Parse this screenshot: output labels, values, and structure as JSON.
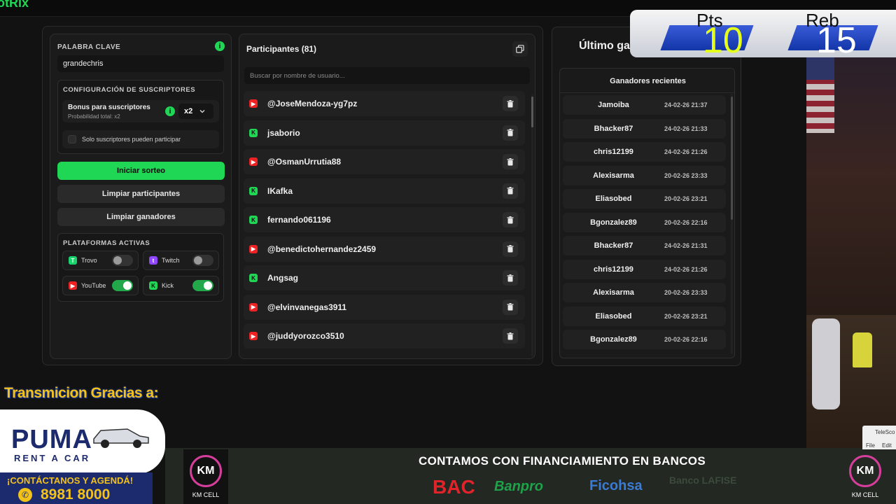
{
  "brand": "otRix",
  "left": {
    "keyword_label": "PALABRA CLAVE",
    "keyword_value": "grandechris",
    "subs_config_label": "CONFIGURACIÓN DE SUSCRIPTORES",
    "bonus_title": "Bonus para suscriptores",
    "bonus_sub": "Probabilidad total: x2",
    "bonus_select": "x2",
    "only_subs": "Solo suscriptores pueden participar",
    "start_btn": "Iniciar sorteo",
    "clear_participants_btn": "Limpiar participantes",
    "clear_winners_btn": "Limpiar ganadores",
    "platforms_label": "PLATAFORMAS ACTIVAS",
    "platforms": [
      {
        "name": "Trovo",
        "icon": "trovo-icon",
        "on": false
      },
      {
        "name": "Twitch",
        "icon": "twitch-icon",
        "on": false
      },
      {
        "name": "YouTube",
        "icon": "youtube-icon",
        "on": true
      },
      {
        "name": "Kick",
        "icon": "kick-icon",
        "on": true
      }
    ]
  },
  "participants": {
    "title": "Participantes (81)",
    "search_placeholder": "Buscar por nombre de usuario...",
    "items": [
      {
        "name": "@JoseMendoza-yg7pz",
        "platform": "youtube"
      },
      {
        "name": "jsaborio",
        "platform": "kick"
      },
      {
        "name": "@OsmanUrrutia88",
        "platform": "youtube"
      },
      {
        "name": "IKafka",
        "platform": "kick"
      },
      {
        "name": "fernando061196",
        "platform": "kick"
      },
      {
        "name": "@benedictohernandez2459",
        "platform": "youtube"
      },
      {
        "name": "Angsag",
        "platform": "kick"
      },
      {
        "name": "@elvinvanegas3911",
        "platform": "youtube"
      },
      {
        "name": "@juddyorozco3510",
        "platform": "youtube"
      }
    ]
  },
  "winners": {
    "header": "Último ga",
    "title": "Ganadores recientes",
    "items": [
      {
        "name": "Jamoiba",
        "date": "24-02-26 21:37"
      },
      {
        "name": "Bhacker87",
        "date": "24-02-26 21:33"
      },
      {
        "name": "chris12199",
        "date": "24-02-26 21:26"
      },
      {
        "name": "Alexisarma",
        "date": "20-02-26 23:33"
      },
      {
        "name": "Eliasobed",
        "date": "20-02-26 23:21"
      },
      {
        "name": "Bgonzalez89",
        "date": "20-02-26 22:16"
      },
      {
        "name": "Bhacker87",
        "date": "24-02-26 21:31"
      },
      {
        "name": "chris12199",
        "date": "24-02-26 21:26"
      },
      {
        "name": "Alexisarma",
        "date": "20-02-26 23:33"
      },
      {
        "name": "Eliasobed",
        "date": "20-02-26 23:21"
      },
      {
        "name": "Bgonzalez89",
        "date": "20-02-26 22:16"
      }
    ]
  },
  "scoreboard": {
    "pts_label": "Pts",
    "pts_value": "10",
    "reb_label": "Reb",
    "reb_value": "15"
  },
  "overlay": {
    "thanks": "Transmicion Gracias a:",
    "puma": "PUMA",
    "puma_sub": "RENT A CAR",
    "contact": "¡CONTÁCTANOS Y AGENDÁ!",
    "phone": "8981 8000",
    "km": "KM CELL",
    "financing": "CONTAMOS CON FINANCIAMIENTO EN BANCOS",
    "banks": [
      "BAC",
      "Banpro",
      "Ficohsa",
      "Banco LAFISE"
    ],
    "window_title": "TeleSco",
    "menu": [
      "File",
      "Edit"
    ]
  },
  "colors": {
    "accent": "#1fd655",
    "youtube": "#e22",
    "twitch": "#9146ff",
    "scoreboard_blue": "#1235a8"
  }
}
